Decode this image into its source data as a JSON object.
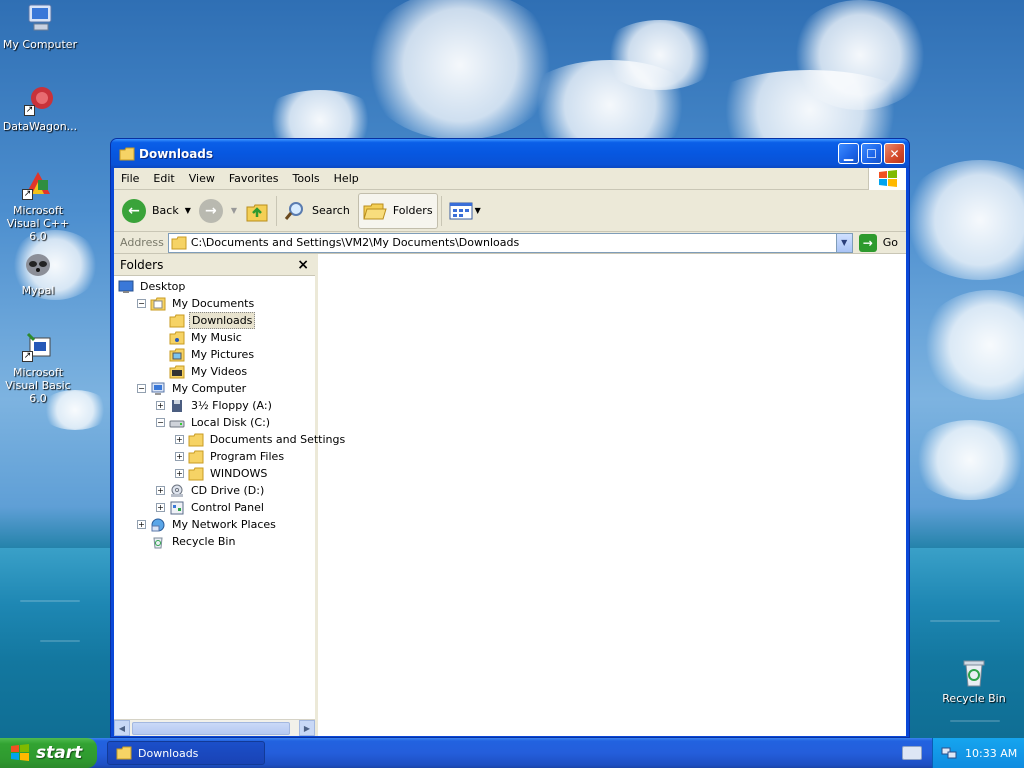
{
  "desktop": {
    "icons": [
      {
        "label": "My Computer",
        "icon": "my-computer-icon"
      },
      {
        "label": "DataWagon...",
        "icon": "datawagon-icon"
      },
      {
        "label": "Microsoft Visual C++ 6.0",
        "icon": "visual-cpp-icon"
      },
      {
        "label": "Mypal",
        "icon": "mypal-icon"
      },
      {
        "label": "Microsoft Visual Basic 6.0",
        "icon": "visual-basic-icon"
      },
      {
        "label": "Recycle Bin",
        "icon": "recycle-bin-icon"
      }
    ]
  },
  "window": {
    "title": "Downloads",
    "menu": [
      "File",
      "Edit",
      "View",
      "Favorites",
      "Tools",
      "Help"
    ],
    "toolbar": {
      "back_label": "Back",
      "search_label": "Search",
      "folders_label": "Folders"
    },
    "address": {
      "label": "Address",
      "value": "C:\\Documents and Settings\\VM2\\My Documents\\Downloads",
      "go_label": "Go"
    },
    "folders_pane": {
      "title": "Folders",
      "close": "×",
      "tree": [
        {
          "label": "Desktop",
          "depth": 0,
          "expander": "",
          "icon": "desktop-icon"
        },
        {
          "label": "My Documents",
          "depth": 1,
          "expander": "−",
          "icon": "my-documents-icon"
        },
        {
          "label": "Downloads",
          "depth": 2,
          "expander": "",
          "icon": "folder-icon",
          "selected": true
        },
        {
          "label": "My Music",
          "depth": 2,
          "expander": "",
          "icon": "music-folder-icon"
        },
        {
          "label": "My Pictures",
          "depth": 2,
          "expander": "",
          "icon": "pictures-folder-icon"
        },
        {
          "label": "My Videos",
          "depth": 2,
          "expander": "",
          "icon": "videos-folder-icon"
        },
        {
          "label": "My Computer",
          "depth": 1,
          "expander": "−",
          "icon": "my-computer-icon"
        },
        {
          "label": "3½ Floppy (A:)",
          "depth": 2,
          "expander": "+",
          "icon": "floppy-icon"
        },
        {
          "label": "Local Disk (C:)",
          "depth": 2,
          "expander": "−",
          "icon": "disk-icon"
        },
        {
          "label": "Documents and Settings",
          "depth": 3,
          "expander": "+",
          "icon": "folder-icon"
        },
        {
          "label": "Program Files",
          "depth": 3,
          "expander": "+",
          "icon": "folder-icon"
        },
        {
          "label": "WINDOWS",
          "depth": 3,
          "expander": "+",
          "icon": "folder-icon"
        },
        {
          "label": "CD Drive (D:)",
          "depth": 2,
          "expander": "+",
          "icon": "cd-drive-icon"
        },
        {
          "label": "Control Panel",
          "depth": 2,
          "expander": "+",
          "icon": "control-panel-icon"
        },
        {
          "label": "My Network Places",
          "depth": 1,
          "expander": "+",
          "icon": "network-places-icon"
        },
        {
          "label": "Recycle Bin",
          "depth": 1,
          "expander": "",
          "icon": "recycle-bin-icon"
        }
      ]
    }
  },
  "taskbar": {
    "start_label": "start",
    "tasks": [
      {
        "label": "Downloads"
      }
    ],
    "clock": "10:33 AM"
  }
}
